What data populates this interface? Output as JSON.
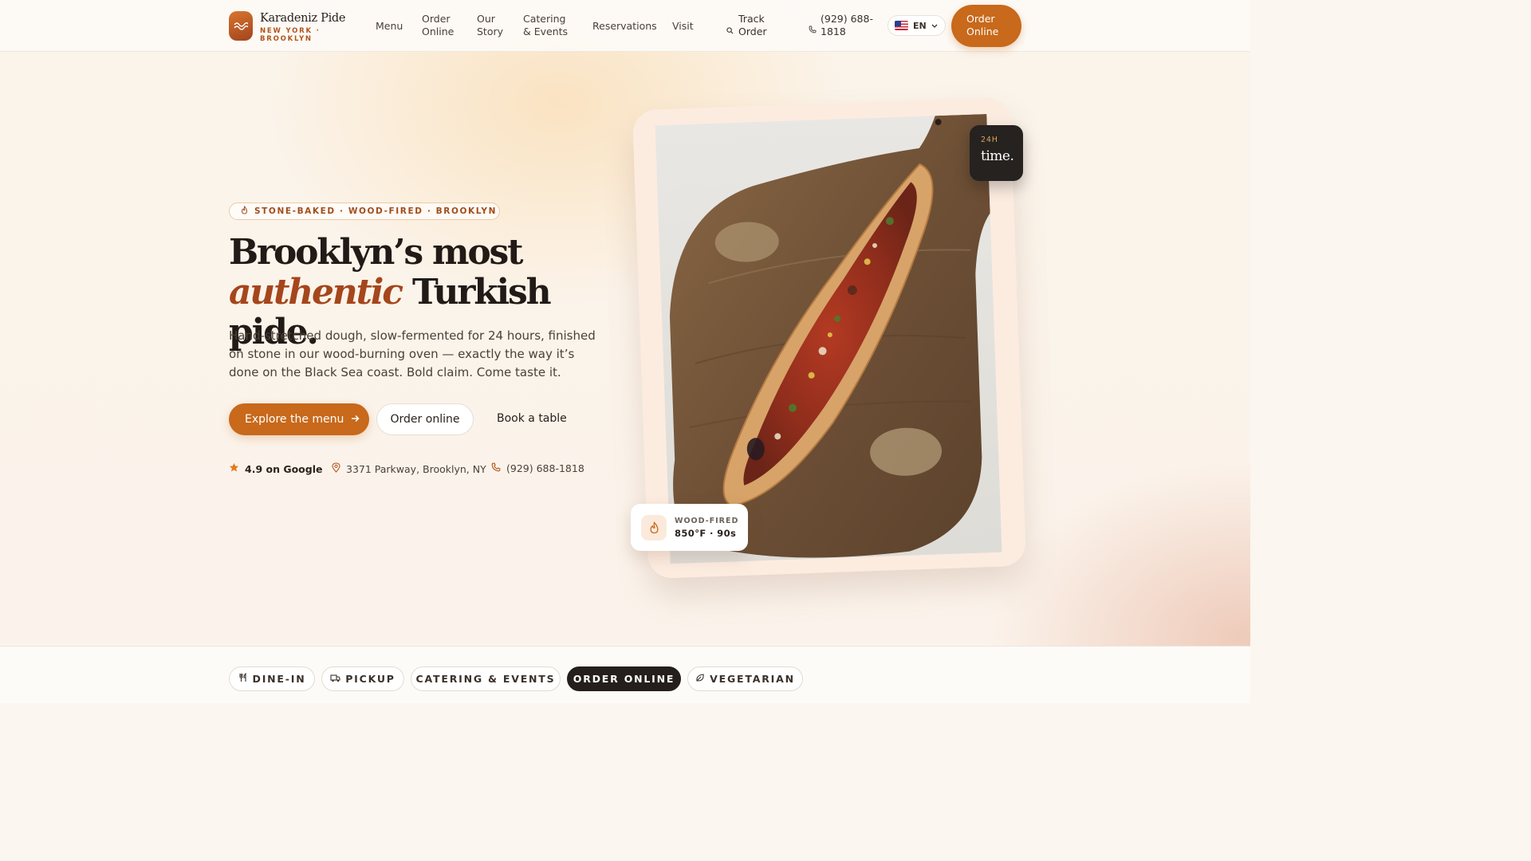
{
  "brand": {
    "name": "Karadeniz Pide",
    "location": "NEW YORK · BROOKLYN"
  },
  "nav": {
    "items": [
      {
        "label": "Menu"
      },
      {
        "label": "Order Online"
      },
      {
        "label": "Our Story"
      },
      {
        "label": "Catering & Events"
      },
      {
        "label": "Reservations"
      },
      {
        "label": "Visit"
      }
    ],
    "track_order": "Track Order",
    "phone": "(929) 688-1818",
    "language": "EN",
    "order_button": "Order Online"
  },
  "hero": {
    "tagline": "STONE-BAKED · WOOD-FIRED · BROOKLYN",
    "title_line1": "Brooklyn’s most",
    "title_accent": "authentic",
    "title_line2_rest": " Turkish pide.",
    "description": "Hand-stretched dough, slow-fermented for 24 hours, finished on stone in our wood-burning oven — exactly the way it’s done on the Black Sea coast. Bold claim. Come taste it.",
    "cta_primary": "Explore the menu",
    "cta_secondary": "Order online",
    "cta_tertiary": "Book a table",
    "rating": "4.9 on Google",
    "address": "3371 Parkway, Brooklyn, NY",
    "phone": "(929) 688-1818"
  },
  "photo": {
    "badge_top_label": "24H",
    "badge_top_value": "time.",
    "badge_bottom_label": "WOOD-FIRED",
    "badge_bottom_value": "850°F · 90s"
  },
  "service_chips": [
    {
      "label": "DINE-IN",
      "icon": "utensils-icon",
      "active": false
    },
    {
      "label": "PICKUP",
      "icon": "truck-icon",
      "active": false
    },
    {
      "label": "CATERING & EVENTS",
      "icon": "",
      "active": false
    },
    {
      "label": "ORDER ONLINE",
      "icon": "",
      "active": true
    },
    {
      "label": "VEGETARIAN",
      "icon": "leaf-icon",
      "active": false
    }
  ],
  "colors": {
    "accent": "#c8691b",
    "accent_dark": "#a5461c",
    "ink": "#221a16",
    "chip_active": "#241f1c"
  }
}
